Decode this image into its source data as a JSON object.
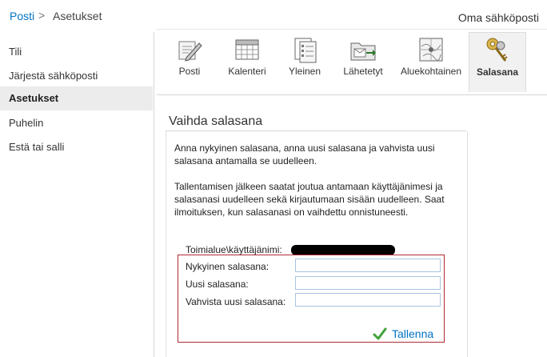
{
  "breadcrumb": {
    "root": "Posti",
    "separator": ">",
    "current": "Asetukset"
  },
  "header": {
    "right_title": "Oma sähköposti"
  },
  "sidebar": {
    "items": [
      {
        "label": "Tili"
      },
      {
        "label": "Järjestä sähköposti"
      },
      {
        "label": "Asetukset",
        "active": true
      },
      {
        "label": "Puhelin"
      },
      {
        "label": "Estä tai salli"
      }
    ]
  },
  "tabs": [
    {
      "label": "Posti",
      "icon": "mail-pen-icon"
    },
    {
      "label": "Kalenteri",
      "icon": "calendar-icon"
    },
    {
      "label": "Yleinen",
      "icon": "document-checklist-icon"
    },
    {
      "label": "Lähetetyt",
      "icon": "folder-sent-icon"
    },
    {
      "label": "Aluekohtainen",
      "icon": "regional-map-icon"
    },
    {
      "label": "Salasana",
      "icon": "keys-icon",
      "active": true
    }
  ],
  "section": {
    "title": "Vaihda salasana",
    "paragraph1": "Anna nykyinen salasana, anna uusi salasana ja vahvista uusi salasana antamalla se uudelleen.",
    "paragraph2": "Tallentamisen jälkeen saatat joutua antamaan käyttäjänimesi ja salasanasi uudelleen sekä kirjautumaan sisään uudelleen. Saat ilmoituksen, kun salasanasi on vaihdettu onnistuneesti."
  },
  "form": {
    "username_label": "Toimialue\\käyttäjänimi:",
    "current_label": "Nykyinen salasana:",
    "new_label": "Uusi salasana:",
    "confirm_label": "Vahvista uusi salasana:",
    "current_value": "",
    "new_value": "",
    "confirm_value": "",
    "save_label": "Tallenna"
  },
  "colors": {
    "link": "#0072c6",
    "highlight_box": "#b02a33",
    "save_check": "#3fa33a"
  }
}
